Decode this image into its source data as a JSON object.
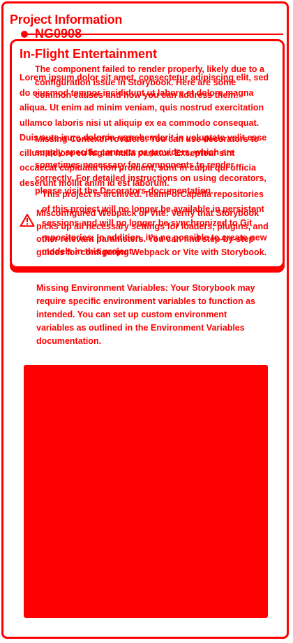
{
  "project": {
    "section_title": "Project Information",
    "project_id": "NG0908"
  },
  "panel": {
    "title": "In-Flight Entertainment",
    "lorem": "Lorem ipsum dolor sit amet, consectetur adipiscing elit, sed do eiusmod tempor incididunt ut labore et dolore magna aliqua. Ut enim ad minim veniam, quis nostrud exercitation ullamco laboris nisi ut aliquip ex ea commodo consequat. Duis aute irure dolor in reprehenderit in voluptate velit esse cillum dolore eu fugiat nulla pariatur. Excepteur sint occaecat cupidatat non proident, sunt in culpa qui officia deserunt mollit anim id est laborum."
  },
  "error": {
    "intro": "The component failed to render properly, likely due to a configuration issue in Storybook. Here are some common causes and how you can address them:",
    "context_providers": "Missing Context/Providers: You can use decorators to supply specific contexts or providers, which are sometimes necessary for components to render correctly. For detailed instructions on using decorators, please visit the Decorators documentation.",
    "archived": "This project is archived. TeamForCapella repositories of this project will no longer be available in persistent sessions and will no longer be synchronized to Git repositories. In addition, it's no possible to create new models in this project.",
    "misconfigured": "Misconfigured Webpack or Vite: Verify that Storybook picks up all necessary settings for loaders, plugins, and other relevant parameters. You can find step-by-step guides for configuring Webpack or Vite with Storybook.",
    "missing_env": "Missing Environment Variables: Your Storybook may require specific environment variables to function as intended. You can set up custom environment variables as outlined in the Environment Variables documentation."
  },
  "icons": {
    "warning": "warning-icon"
  },
  "colors": {
    "accent": "#ff0000",
    "background": "#ffffff"
  }
}
